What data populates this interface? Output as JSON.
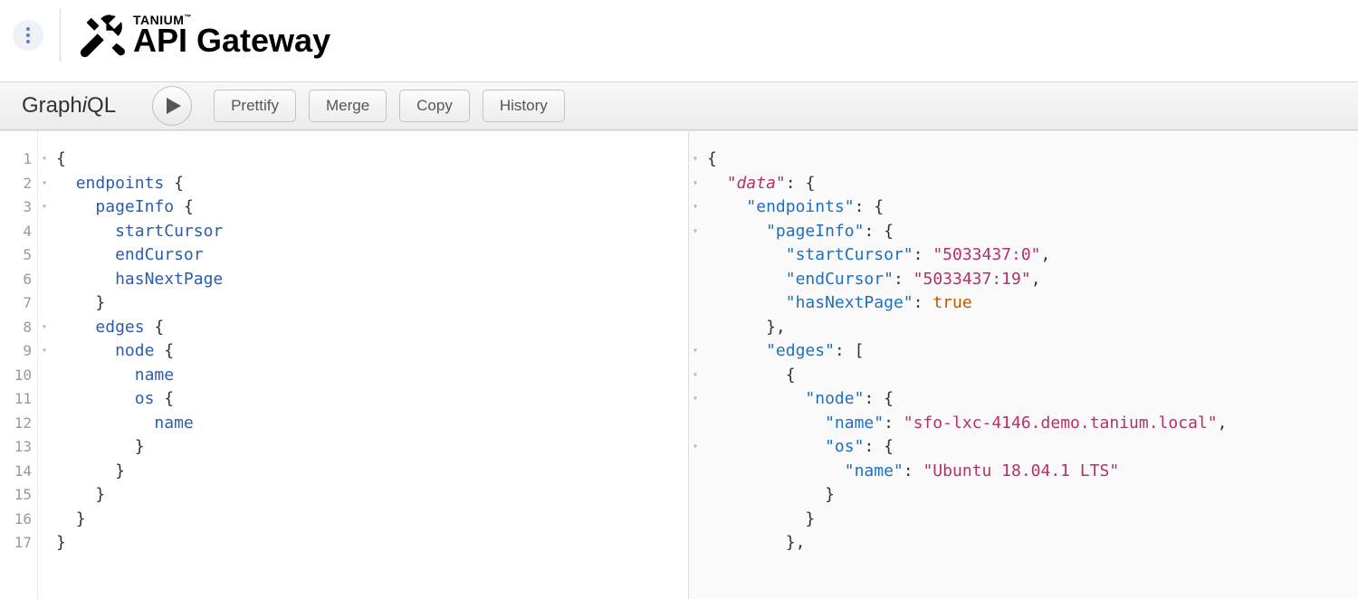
{
  "brand": {
    "small": "TANIUM",
    "tm": "™",
    "product": "API Gateway"
  },
  "toolbar": {
    "logo_prefix": "Graph",
    "logo_i": "i",
    "logo_suffix": "QL",
    "play_icon": "play-icon",
    "buttons": {
      "prettify": "Prettify",
      "merge": "Merge",
      "copy": "Copy",
      "history": "History"
    }
  },
  "query_editor": {
    "line_numbers": [
      "1",
      "2",
      "3",
      "4",
      "5",
      "6",
      "7",
      "8",
      "9",
      "10",
      "11",
      "12",
      "13",
      "14",
      "15",
      "16",
      "17"
    ],
    "fold_markers": [
      "▾",
      "▾",
      "▾",
      "",
      "",
      "",
      "",
      "▾",
      "▾",
      "",
      "",
      "",
      "",
      "",
      "",
      "",
      ""
    ],
    "lines": [
      {
        "indent": 0,
        "tokens": [
          {
            "t": "{",
            "c": "pn"
          }
        ]
      },
      {
        "indent": 1,
        "tokens": [
          {
            "t": "endpoints ",
            "c": "fld"
          },
          {
            "t": "{",
            "c": "pn"
          }
        ]
      },
      {
        "indent": 2,
        "tokens": [
          {
            "t": "pageInfo ",
            "c": "fld"
          },
          {
            "t": "{",
            "c": "pn"
          }
        ]
      },
      {
        "indent": 3,
        "tokens": [
          {
            "t": "startCursor",
            "c": "fld"
          }
        ]
      },
      {
        "indent": 3,
        "tokens": [
          {
            "t": "endCursor",
            "c": "fld"
          }
        ]
      },
      {
        "indent": 3,
        "tokens": [
          {
            "t": "hasNextPage",
            "c": "fld"
          }
        ]
      },
      {
        "indent": 2,
        "tokens": [
          {
            "t": "}",
            "c": "pn"
          }
        ]
      },
      {
        "indent": 2,
        "tokens": [
          {
            "t": "edges ",
            "c": "fld"
          },
          {
            "t": "{",
            "c": "pn"
          }
        ]
      },
      {
        "indent": 3,
        "tokens": [
          {
            "t": "node ",
            "c": "fld"
          },
          {
            "t": "{",
            "c": "pn"
          }
        ]
      },
      {
        "indent": 4,
        "tokens": [
          {
            "t": "name",
            "c": "fld"
          }
        ]
      },
      {
        "indent": 4,
        "tokens": [
          {
            "t": "os ",
            "c": "fld"
          },
          {
            "t": "{",
            "c": "pn"
          }
        ]
      },
      {
        "indent": 5,
        "tokens": [
          {
            "t": "name",
            "c": "fld"
          }
        ]
      },
      {
        "indent": 4,
        "tokens": [
          {
            "t": "}",
            "c": "pn"
          }
        ]
      },
      {
        "indent": 3,
        "tokens": [
          {
            "t": "}",
            "c": "pn"
          }
        ]
      },
      {
        "indent": 2,
        "tokens": [
          {
            "t": "}",
            "c": "pn"
          }
        ]
      },
      {
        "indent": 1,
        "tokens": [
          {
            "t": "}",
            "c": "pn"
          }
        ]
      },
      {
        "indent": 0,
        "tokens": [
          {
            "t": "}",
            "c": "pn"
          }
        ]
      }
    ]
  },
  "result_editor": {
    "fold_markers": [
      "▾",
      "▾",
      "▾",
      "▾",
      "",
      "",
      "",
      "",
      "▾",
      "▾",
      "▾",
      "",
      "▾",
      "",
      "",
      "",
      ""
    ],
    "lines": [
      {
        "indent": 0,
        "tokens": [
          {
            "t": "{",
            "c": "pn"
          }
        ]
      },
      {
        "indent": 1,
        "tokens": [
          {
            "t": "\"data\"",
            "c": "datakey"
          },
          {
            "t": ": ",
            "c": "pn"
          },
          {
            "t": "{",
            "c": "pn"
          }
        ]
      },
      {
        "indent": 2,
        "tokens": [
          {
            "t": "\"endpoints\"",
            "c": "key"
          },
          {
            "t": ": ",
            "c": "pn"
          },
          {
            "t": "{",
            "c": "pn"
          }
        ]
      },
      {
        "indent": 3,
        "tokens": [
          {
            "t": "\"pageInfo\"",
            "c": "key"
          },
          {
            "t": ": ",
            "c": "pn"
          },
          {
            "t": "{",
            "c": "pn"
          }
        ]
      },
      {
        "indent": 4,
        "tokens": [
          {
            "t": "\"startCursor\"",
            "c": "key"
          },
          {
            "t": ": ",
            "c": "pn"
          },
          {
            "t": "\"5033437:0\"",
            "c": "str"
          },
          {
            "t": ",",
            "c": "pn"
          }
        ]
      },
      {
        "indent": 4,
        "tokens": [
          {
            "t": "\"endCursor\"",
            "c": "key"
          },
          {
            "t": ": ",
            "c": "pn"
          },
          {
            "t": "\"5033437:19\"",
            "c": "str"
          },
          {
            "t": ",",
            "c": "pn"
          }
        ]
      },
      {
        "indent": 4,
        "tokens": [
          {
            "t": "\"hasNextPage\"",
            "c": "key"
          },
          {
            "t": ": ",
            "c": "pn"
          },
          {
            "t": "true",
            "c": "kw"
          }
        ]
      },
      {
        "indent": 3,
        "tokens": [
          {
            "t": "}",
            "c": "pn"
          },
          {
            "t": ",",
            "c": "pn"
          }
        ]
      },
      {
        "indent": 3,
        "tokens": [
          {
            "t": "\"edges\"",
            "c": "key"
          },
          {
            "t": ": ",
            "c": "pn"
          },
          {
            "t": "[",
            "c": "pn"
          }
        ]
      },
      {
        "indent": 4,
        "tokens": [
          {
            "t": "{",
            "c": "pn"
          }
        ]
      },
      {
        "indent": 5,
        "tokens": [
          {
            "t": "\"node\"",
            "c": "key"
          },
          {
            "t": ": ",
            "c": "pn"
          },
          {
            "t": "{",
            "c": "pn"
          }
        ]
      },
      {
        "indent": 6,
        "tokens": [
          {
            "t": "\"name\"",
            "c": "key"
          },
          {
            "t": ": ",
            "c": "pn"
          },
          {
            "t": "\"sfo-lxc-4146.demo.tanium.local\"",
            "c": "str"
          },
          {
            "t": ",",
            "c": "pn"
          }
        ]
      },
      {
        "indent": 6,
        "tokens": [
          {
            "t": "\"os\"",
            "c": "key"
          },
          {
            "t": ": ",
            "c": "pn"
          },
          {
            "t": "{",
            "c": "pn"
          }
        ]
      },
      {
        "indent": 7,
        "tokens": [
          {
            "t": "\"name\"",
            "c": "key"
          },
          {
            "t": ": ",
            "c": "pn"
          },
          {
            "t": "\"Ubuntu 18.04.1 LTS\"",
            "c": "str"
          }
        ]
      },
      {
        "indent": 6,
        "tokens": [
          {
            "t": "}",
            "c": "pn"
          }
        ]
      },
      {
        "indent": 5,
        "tokens": [
          {
            "t": "}",
            "c": "pn"
          }
        ]
      },
      {
        "indent": 4,
        "tokens": [
          {
            "t": "}",
            "c": "pn"
          },
          {
            "t": ",",
            "c": "pn"
          }
        ]
      }
    ]
  }
}
